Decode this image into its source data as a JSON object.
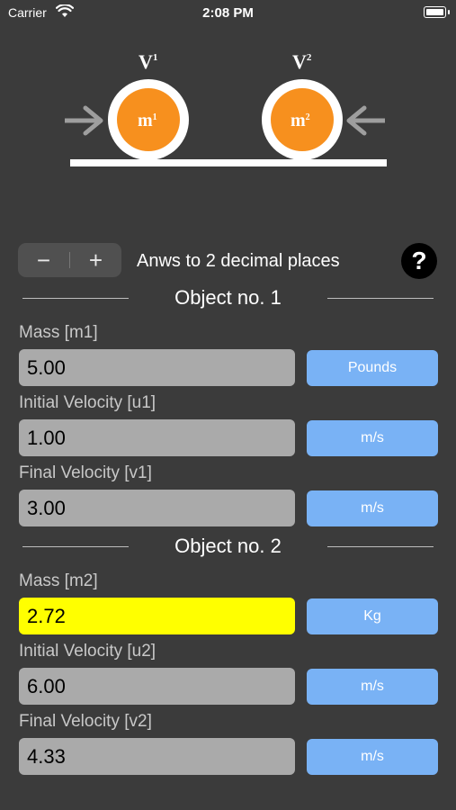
{
  "status_bar": {
    "carrier": "Carrier",
    "time": "2:08 PM"
  },
  "diagram": {
    "v1_label": "V",
    "v1_sup": "1",
    "v2_label": "V",
    "v2_sup": "2",
    "m1_label": "m",
    "m1_sup": "1",
    "m2_label": "m",
    "m2_sup": "2",
    "ball_color": "#f7901e",
    "ring_color": "#ffffff",
    "arrow_color": "#9e9e9e"
  },
  "controls": {
    "minus": "−",
    "plus": "+",
    "precision_label": "Anws to 2 decimal places",
    "help": "?"
  },
  "object1": {
    "title": "Object no. 1",
    "mass_label": "Mass [m1]",
    "mass_value": "5.00",
    "mass_unit": "Pounds",
    "initial_velocity_label": "Initial Velocity [u1]",
    "initial_velocity_value": "1.00",
    "initial_velocity_unit": "m/s",
    "final_velocity_label": "Final Velocity [v1]",
    "final_velocity_value": "3.00",
    "final_velocity_unit": "m/s"
  },
  "object2": {
    "title": "Object no. 2",
    "mass_label": "Mass [m2]",
    "mass_value": "2.72",
    "mass_unit": "Kg",
    "initial_velocity_label": "Initial Velocity [u2]",
    "initial_velocity_value": "6.00",
    "initial_velocity_unit": "m/s",
    "final_velocity_label": "Final Velocity [v2]",
    "final_velocity_value": "4.33",
    "final_velocity_unit": "m/s"
  },
  "colors": {
    "background": "#3b3b3b",
    "input": "#aaaaaa",
    "highlight": "#ffff00",
    "unit_button": "#79b2f5"
  }
}
